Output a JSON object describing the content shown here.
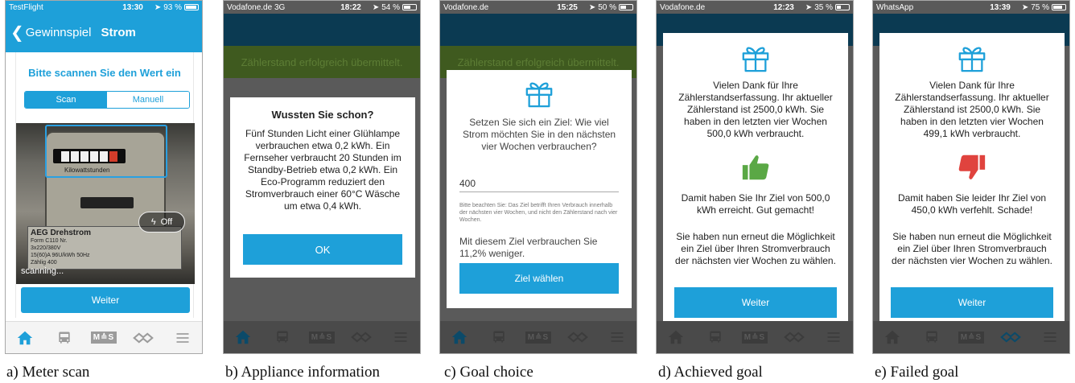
{
  "colors": {
    "accent": "#1ea0d9",
    "thumb_up": "#5aa845",
    "thumb_down": "#e0433e",
    "banner_text": "#5d7d35"
  },
  "panels": [
    {
      "status": {
        "left": "TestFlight",
        "time": "13:30",
        "battery": "93 %",
        "battery_level": 0.93
      },
      "nav": {
        "back_label": "Gewinnspiel",
        "title": "Strom"
      },
      "heading": "Bitte scannen Sie den Wert ein",
      "segments": [
        "Scan",
        "Manuell"
      ],
      "camera": {
        "kwh_label": "Kilowattstunden",
        "plate_brand": "AEG Drehstrom",
        "plate_lines": [
          "Form C110   Nr.",
          "3x220/380V",
          "15(60)A   96U/kWh   50Hz",
          "Zählig 400"
        ],
        "torch_label": "Off",
        "scanning": "scanning..."
      },
      "button": "Weiter",
      "caption": "a) Meter scan"
    },
    {
      "status": {
        "left": "Vodafone.de  3G",
        "time": "18:22",
        "battery": "54 %",
        "battery_level": 0.54
      },
      "banner": "Zählerstand erfolgreich übermittelt.",
      "title": "Wussten Sie schon?",
      "text": "Fünf Stunden Licht einer Glühlampe verbrauchen etwa 0,2 kWh. Ein Fernseher verbraucht 20 Stunden im Standby-Betrieb etwa 0,2 kWh. Ein Eco-Programm reduziert den Stromverbrauch einer 60°C Wäsche um etwa 0,4 kWh.",
      "button": "OK",
      "caption": "b) Appliance information"
    },
    {
      "status": {
        "left": "Vodafone.de",
        "time": "15:25",
        "battery": "50 %",
        "battery_level": 0.5
      },
      "banner": "Zählerstand erfolgreich übermittelt.",
      "text": "Setzen Sie sich ein Ziel: Wie viel Strom möchten Sie in den nächsten vier Wochen verbrauchen?",
      "input_value": "400",
      "hint": "Bitte beachten Sie: Das Ziel betrifft Ihren Verbrauch innerhalb der nächsten vier Wochen, und nicht den Zählerstand nach vier Wochen.",
      "result": "Mit diesem Ziel verbrauchen Sie 11,2% weniger.",
      "button": "Ziel wählen",
      "caption": "c) Goal choice"
    },
    {
      "status": {
        "left": "Vodafone.de",
        "time": "12:23",
        "battery": "35 %",
        "battery_level": 0.35
      },
      "text1": "Vielen Dank für Ihre Zählerstandserfassung. Ihr aktueller Zählerstand ist 2500,0 kWh. Sie haben in den letzten vier Wochen 500,0 kWh verbraucht.",
      "text2": "Damit haben Sie Ihr Ziel von 500,0 kWh erreicht. Gut gemacht!",
      "text3": "Sie haben nun erneut die Möglichkeit ein Ziel über Ihren Stromverbrauch der nächsten vier Wochen zu wählen.",
      "button": "Weiter",
      "caption": "d) Achieved goal"
    },
    {
      "status": {
        "left": "WhatsApp",
        "time": "13:39",
        "battery": "75 %",
        "battery_level": 0.75
      },
      "text1": "Vielen Dank für Ihre Zählerstandserfassung. Ihr aktueller Zählerstand ist 2500,0 kWh. Sie haben in den letzten vier Wochen 499,1 kWh verbraucht.",
      "text2": "Damit haben Sie leider Ihr Ziel von 450,0 kWh verfehlt. Schade!",
      "text3": "Sie haben nun erneut die Möglichkeit ein Ziel über Ihren Stromverbrauch der nächsten vier Wochen zu wählen.",
      "button": "Weiter",
      "caption": "e) Failed goal"
    }
  ],
  "tabbar": {
    "icons": [
      "home-icon",
      "bus-icon",
      "mas-logo",
      "handshake-icon",
      "menu-icon"
    ],
    "mas_text": "M≙S"
  }
}
